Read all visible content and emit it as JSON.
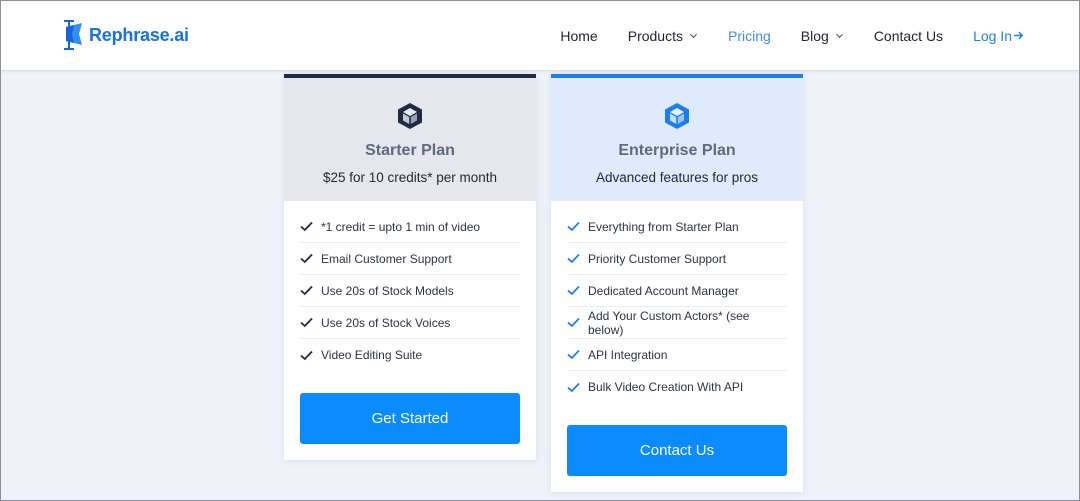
{
  "brand": {
    "name": "Rephrase.ai",
    "color": "#1672e6"
  },
  "nav": {
    "items": [
      {
        "label": "Home"
      },
      {
        "label": "Products"
      },
      {
        "label": "Pricing"
      },
      {
        "label": "Blog"
      },
      {
        "label": "Contact Us"
      }
    ],
    "login": "Log In"
  },
  "plans": [
    {
      "icon": "box-icon",
      "title": "Starter Plan",
      "subtitle": "$25 for 10 credits* per month",
      "features": [
        "*1 credit = upto 1 min of video",
        "Email Customer Support",
        "Use 20s of Stock Models",
        "Use 20s of Stock Voices",
        "Video Editing Suite"
      ],
      "cta": "Get Started"
    },
    {
      "icon": "box-icon",
      "title": "Enterprise Plan",
      "subtitle": "Advanced features for pros",
      "features": [
        "Everything from Starter Plan",
        "Priority Customer Support",
        "Dedicated Account Manager",
        "Add Your Custom Actors* (see below)",
        "API Integration",
        "Bulk Video Creation With API"
      ],
      "cta": "Contact Us"
    }
  ],
  "colors": {
    "accent": "#0a8cff",
    "starter_accent": "#1e2b45",
    "enterprise_accent": "#1a7df0",
    "page_bg": "#eff2f9"
  }
}
